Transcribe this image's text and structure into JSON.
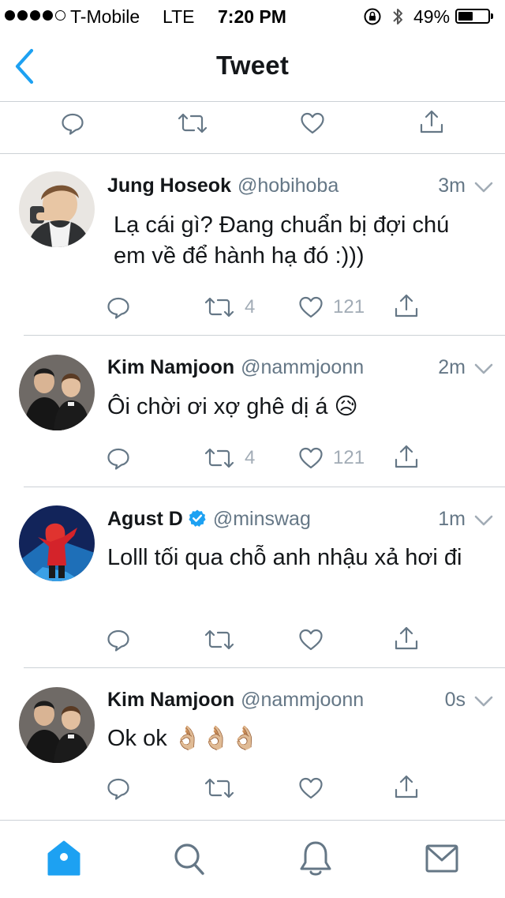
{
  "status_bar": {
    "carrier": "T-Mobile",
    "network": "LTE",
    "time": "7:20 PM",
    "battery": "49%",
    "battery_level": 0.49,
    "icons": [
      "signal-dots",
      "orientation-lock-icon",
      "bluetooth-icon",
      "battery-icon"
    ]
  },
  "nav": {
    "title": "Tweet",
    "back_icon": "chevron-left-icon"
  },
  "colors": {
    "brand_blue": "#1da1f2",
    "icon_gray": "#657786",
    "muted_gray": "#a2acb6",
    "text": "#14171a"
  },
  "tweets": [
    {
      "name": "Jung Hoseok",
      "handle": "@hobihoba",
      "time": "3m",
      "verified": false,
      "text": "Lạ cái gì? Đang chuẩn bị đợi chú em về để hành hạ đó :)))",
      "retweets": "4",
      "likes": "121"
    },
    {
      "name": "Kim Namjoon",
      "handle": "@nammjoonn",
      "time": "2m",
      "verified": false,
      "text": "Ôi chời ơi xợ ghê dị á 😥",
      "retweets": "4",
      "likes": "121"
    },
    {
      "name": "Agust D",
      "handle": "@minswag",
      "time": "1m",
      "verified": true,
      "text": "Lolll tối qua chỗ anh nhậu xả hơi đi",
      "retweets": "",
      "likes": ""
    },
    {
      "name": "Kim Namjoon",
      "handle": "@nammjoonn",
      "time": "0s",
      "verified": false,
      "text": "Ok ok 👌🏼👌🏼👌🏼",
      "retweets": "",
      "likes": ""
    }
  ],
  "tab_bar": {
    "tabs": [
      "home-icon",
      "search-icon",
      "notifications-icon",
      "messages-icon"
    ],
    "active": "home-icon"
  }
}
